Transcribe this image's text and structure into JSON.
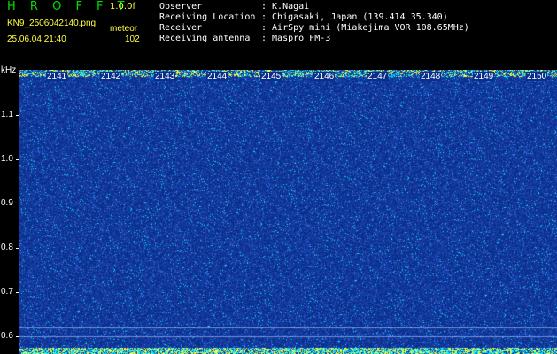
{
  "header": {
    "logo": "H R O F F T",
    "version": "1.0.0f",
    "filename": "KN9_2506042140.png",
    "meteor_label": "meteor",
    "datetime": "25.06.04 21:40",
    "count": "102"
  },
  "info": [
    {
      "label": "Observer",
      "value": ": K.Nagai"
    },
    {
      "label": "Receiving Location",
      "value": ": Chigasaki, Japan (139.414 35.340)"
    },
    {
      "label": "Receiver",
      "value": ": AirSpy mini (Miakejima VOR 108.65MHz)"
    },
    {
      "label": "Receiving antenna",
      "value": ": Maspro FM-3"
    }
  ],
  "spectrogram": {
    "y_unit": "kHz",
    "y_ticks": [
      "1.1",
      "1.0",
      "0.9",
      "0.8",
      "0.7",
      "0.6"
    ],
    "x_ticks": [
      "2141",
      "2142",
      "2143",
      "2144",
      "2145",
      "2146",
      "2147",
      "2148",
      "2149",
      "2150"
    ],
    "colors": {
      "background": "#0a2f8a",
      "noise_low": "#1a44b0",
      "noise_mid": "#3a7ee8",
      "noise_high": "#00e8ff",
      "hot": "#ffff40",
      "line": "#b0c8ff"
    }
  }
}
